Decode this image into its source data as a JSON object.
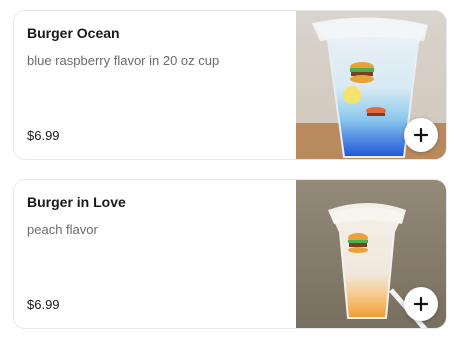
{
  "menu_items": [
    {
      "name": "Burger Ocean",
      "description": "blue raspberry flavor in 20 oz cup",
      "price": "$6.99",
      "image_icon": "drink-photo-blue-raspberry"
    },
    {
      "name": "Burger in Love",
      "description": "peach flavor",
      "price": "$6.99",
      "image_icon": "drink-photo-peach"
    }
  ],
  "actions": {
    "add_icon": "plus-icon"
  },
  "colors": {
    "text_primary": "#191919",
    "text_secondary": "#6b6b6b",
    "card_border": "#e8e8e8"
  }
}
